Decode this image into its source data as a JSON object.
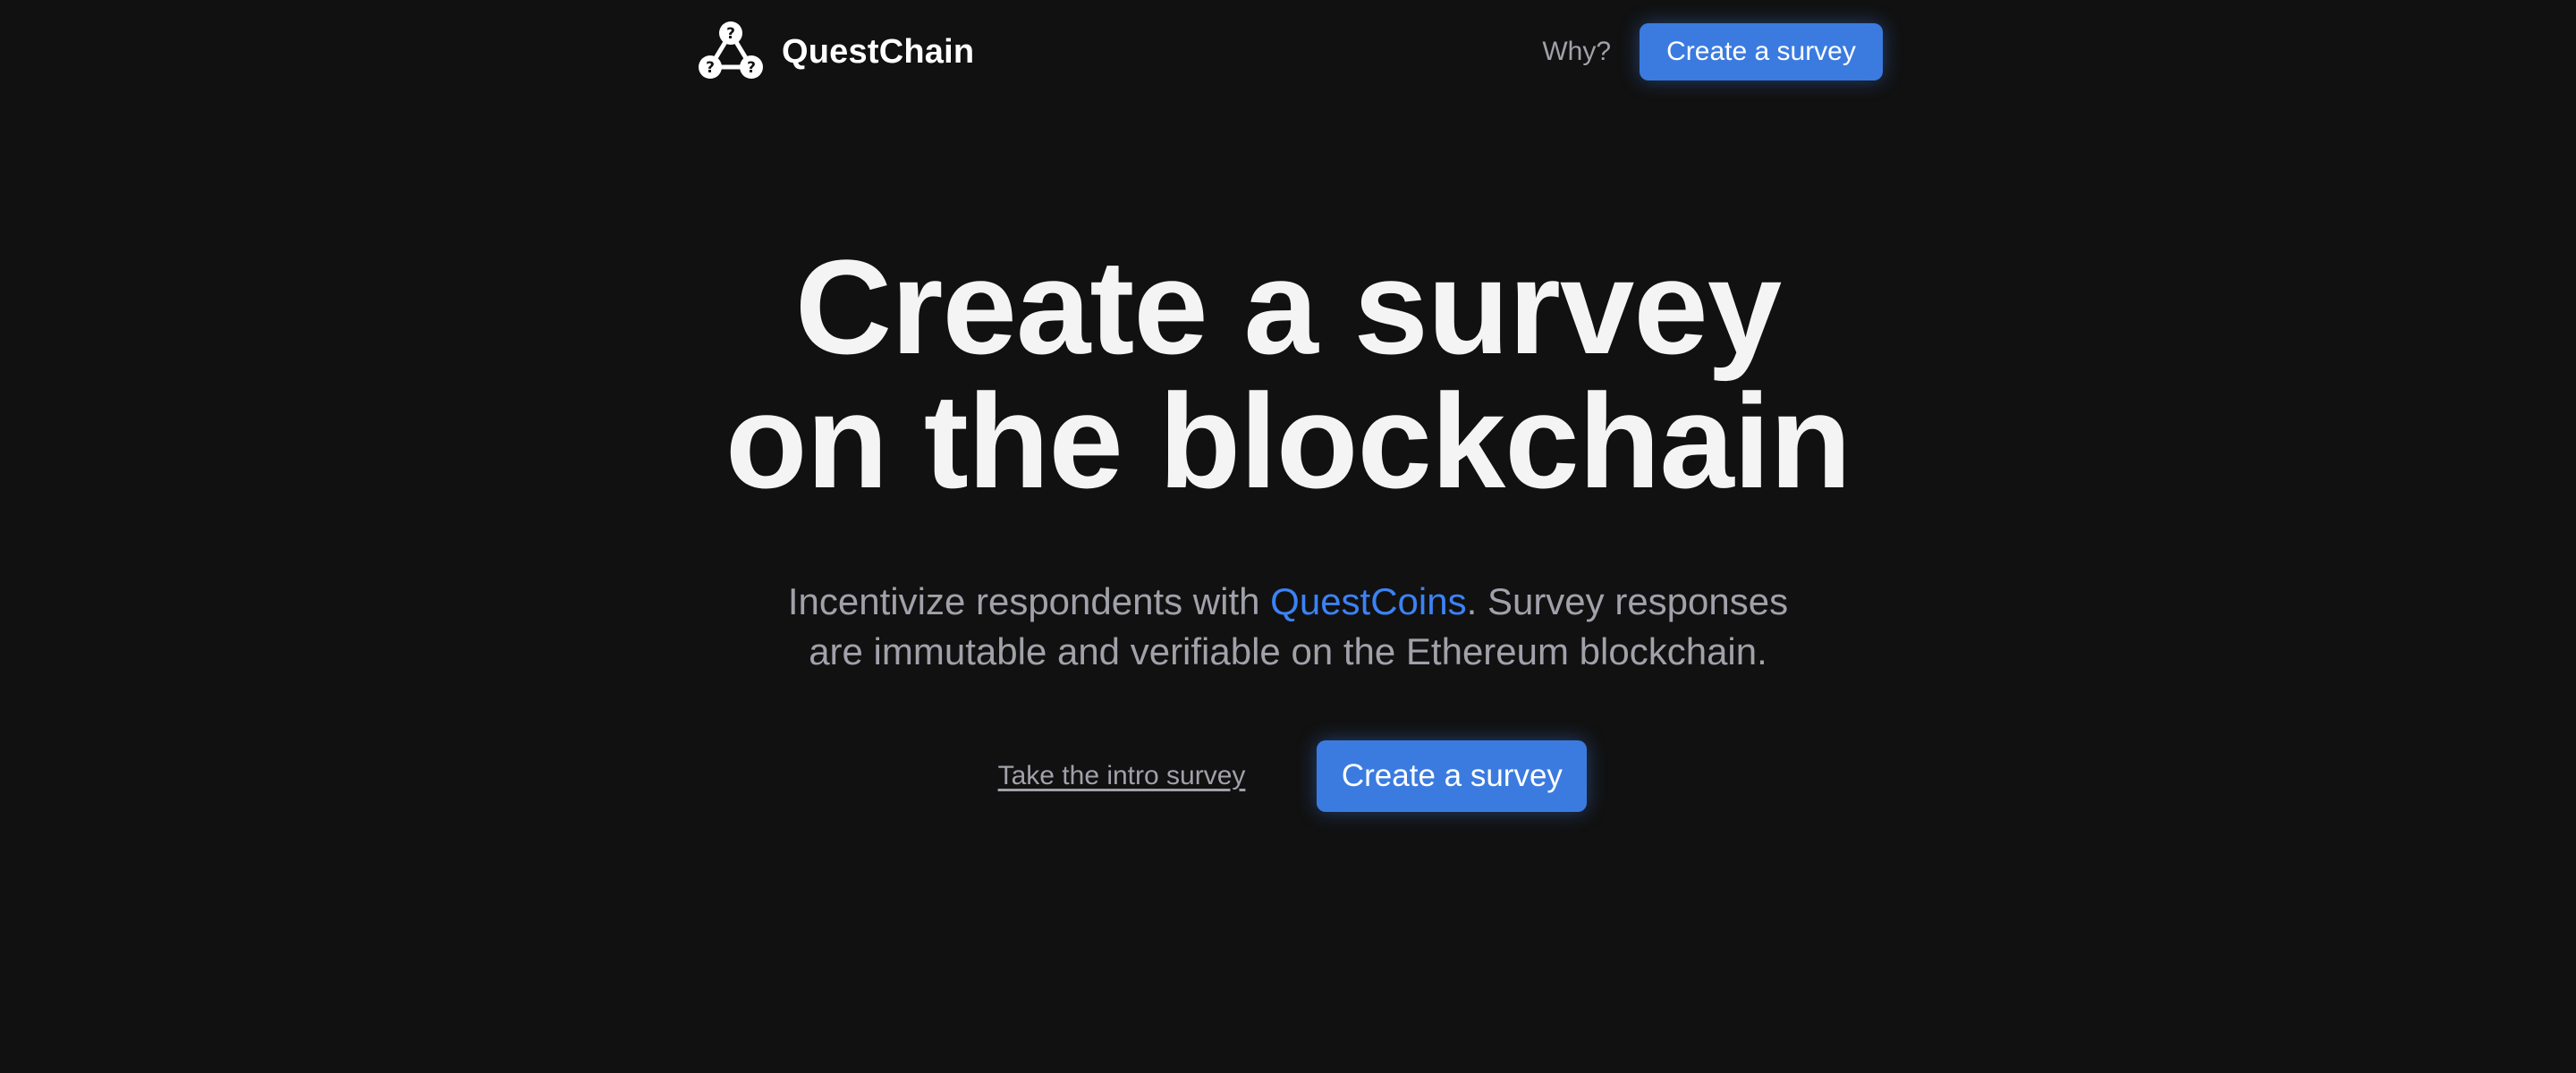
{
  "header": {
    "brand_name": "QuestChain",
    "logo_icon": "questchain-logo-icon",
    "nav_why": "Why?",
    "cta_label": "Create a survey"
  },
  "hero": {
    "title_line1": "Create a survey",
    "title_line2": "on the blockchain",
    "subtitle_pre": "Incentivize respondents with ",
    "subtitle_highlight": "QuestCoins",
    "subtitle_post": ". Survey responses",
    "subtitle_line2": "are immutable and verifiable on the Ethereum blockchain.",
    "intro_link_label": "Take the intro survey",
    "cta_label": "Create a survey"
  },
  "colors": {
    "background": "#111111",
    "accent": "#3b7be0",
    "highlight_text": "#3b82f6",
    "muted_text": "#a1a1aa",
    "heading_text": "#f4f4f5"
  }
}
